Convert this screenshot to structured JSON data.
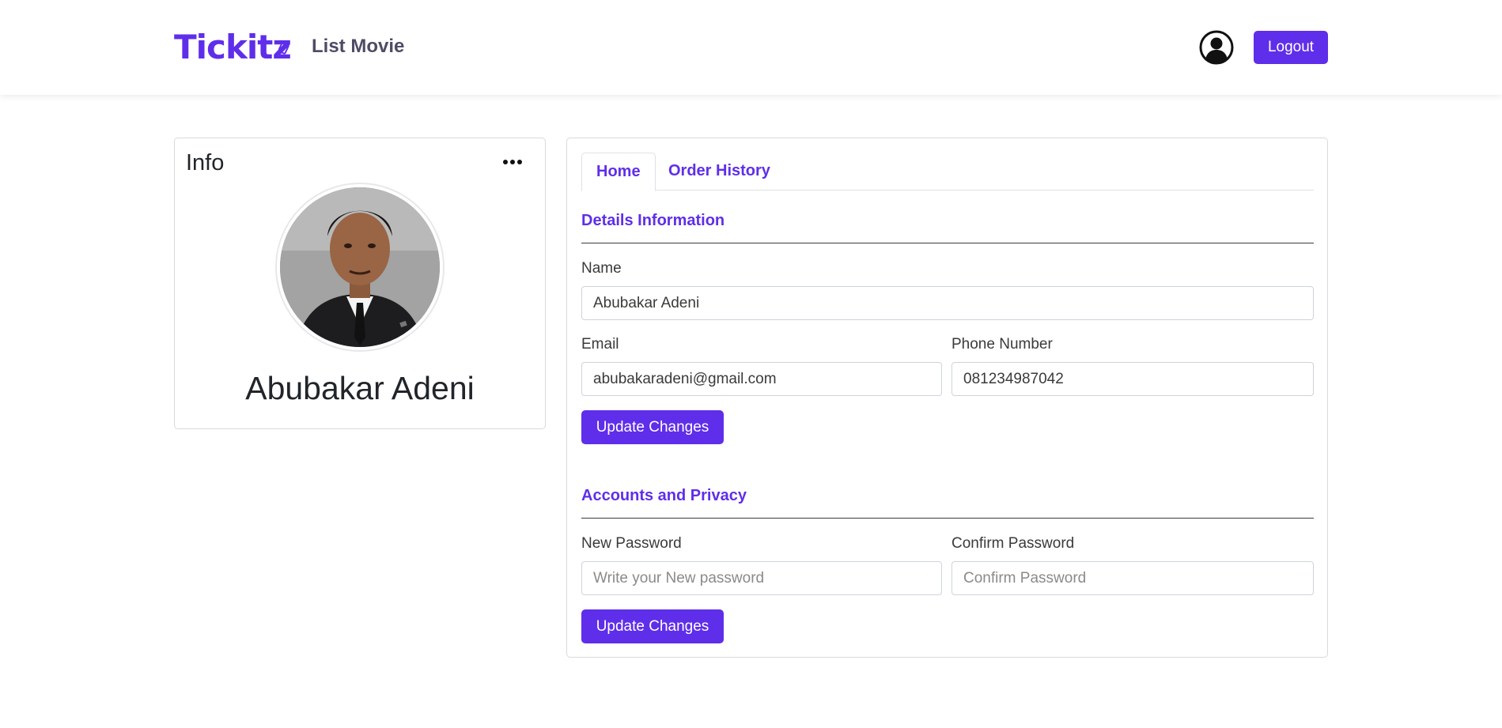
{
  "brand": {
    "logo_text": "Tickitz",
    "accent_color": "#5f2eea"
  },
  "nav": {
    "list_movie": "List Movie",
    "logout": "Logout",
    "user_icon": "user-circle-icon"
  },
  "info": {
    "title": "Info",
    "more_icon": "ellipsis-icon",
    "name": "Abubakar Adeni"
  },
  "tabs": [
    {
      "label": "Home",
      "active": true
    },
    {
      "label": "Order History",
      "active": false
    }
  ],
  "details": {
    "section_title": "Details Information",
    "name_label": "Name",
    "name_value": "Abubakar Adeni",
    "email_label": "Email",
    "email_value": "abubakaradeni@gmail.com",
    "phone_label": "Phone Number",
    "phone_value": "081234987042",
    "submit": "Update Changes"
  },
  "privacy": {
    "section_title": "Accounts and Privacy",
    "new_password_label": "New Password",
    "new_password_placeholder": "Write your New password",
    "confirm_password_label": "Confirm Password",
    "confirm_password_placeholder": "Confirm Password",
    "submit": "Update Changes"
  }
}
